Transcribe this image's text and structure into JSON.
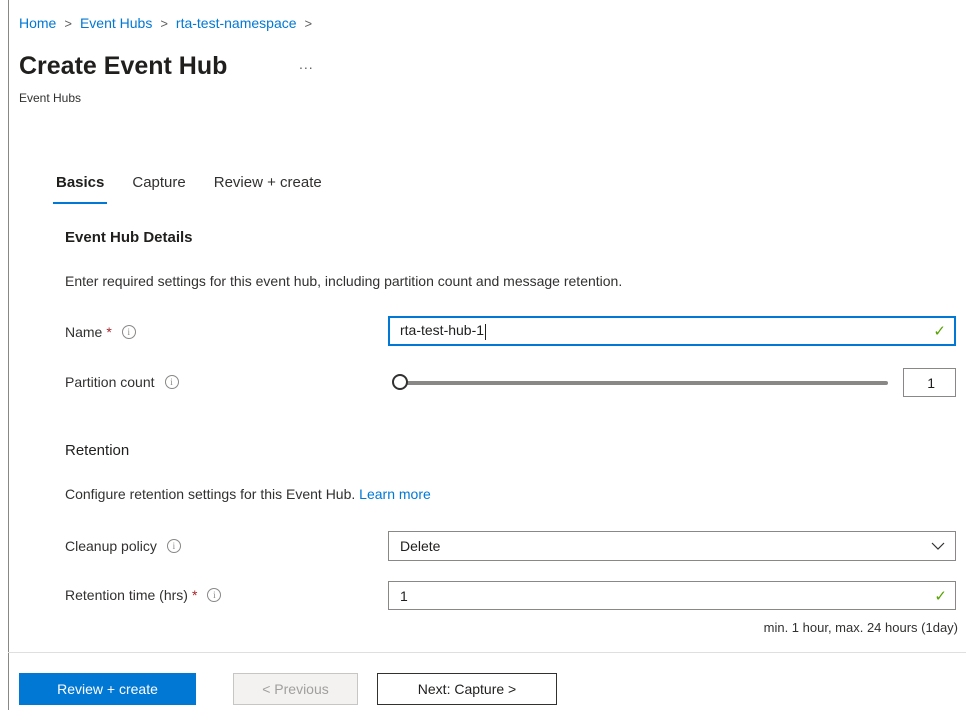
{
  "breadcrumb": {
    "items": [
      "Home",
      "Event Hubs",
      "rta-test-namespace"
    ],
    "separator": ">"
  },
  "header": {
    "title": "Create Event Hub",
    "more": "...",
    "subtitle": "Event Hubs"
  },
  "tabs": [
    {
      "label": "Basics",
      "active": true
    },
    {
      "label": "Capture",
      "active": false
    },
    {
      "label": "Review + create",
      "active": false
    }
  ],
  "details": {
    "heading": "Event Hub Details",
    "description": "Enter required settings for this event hub, including partition count and message retention.",
    "name": {
      "label": "Name",
      "required": "*",
      "value": "rta-test-hub-1",
      "valid": true
    },
    "partition": {
      "label": "Partition count",
      "value": "1",
      "slider_fraction": 0.0
    }
  },
  "retention": {
    "heading": "Retention",
    "description": "Configure retention settings for this Event Hub.",
    "learn_more": "Learn more",
    "cleanup": {
      "label": "Cleanup policy",
      "value": "Delete"
    },
    "time": {
      "label": "Retention time (hrs)",
      "required": "*",
      "value": "1",
      "valid": true,
      "hint": "min. 1 hour, max. 24 hours (1day)"
    }
  },
  "footer": {
    "review_create": "Review + create",
    "previous": "< Previous",
    "next": "Next: Capture >"
  },
  "colors": {
    "accent": "#0078d4",
    "valid": "#57a300",
    "required": "#a4262c"
  },
  "icons": {
    "info": "info-icon",
    "check": "checkmark-icon",
    "chevron": "chevron-down-icon",
    "more": "more-icon"
  }
}
